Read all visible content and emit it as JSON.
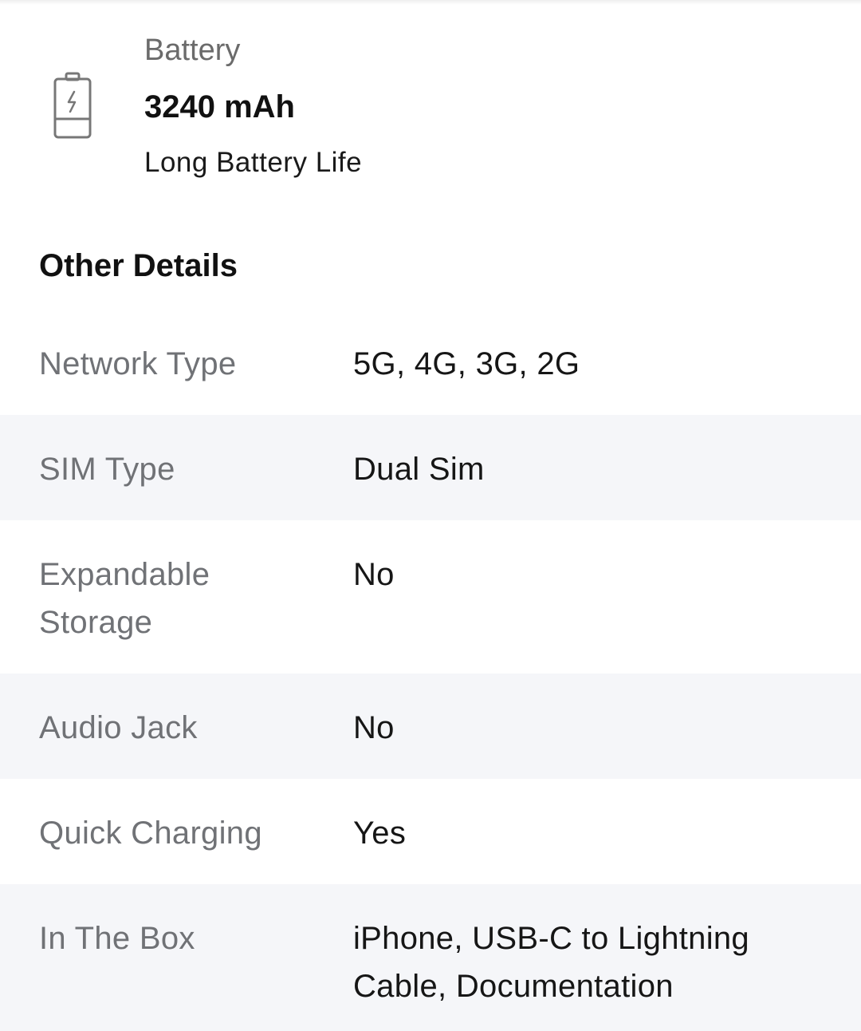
{
  "battery": {
    "label": "Battery",
    "value": "3240 mAh",
    "subtitle": "Long Battery Life",
    "icon": "battery-charging-icon"
  },
  "other_details": {
    "title": "Other Details",
    "rows": [
      {
        "key": "Network Type",
        "value": "5G, 4G, 3G, 2G"
      },
      {
        "key": "SIM Type",
        "value": "Dual Sim"
      },
      {
        "key": "Expandable Storage",
        "value": "No"
      },
      {
        "key": "Audio Jack",
        "value": "No"
      },
      {
        "key": "Quick Charging",
        "value": "Yes"
      },
      {
        "key": "In The Box",
        "value": "iPhone, USB-C to Lightning Cable, Documentation"
      }
    ]
  },
  "colors": {
    "label_gray": "#707276",
    "row_shade": "#f5f6f9",
    "text_dark": "#161616"
  }
}
